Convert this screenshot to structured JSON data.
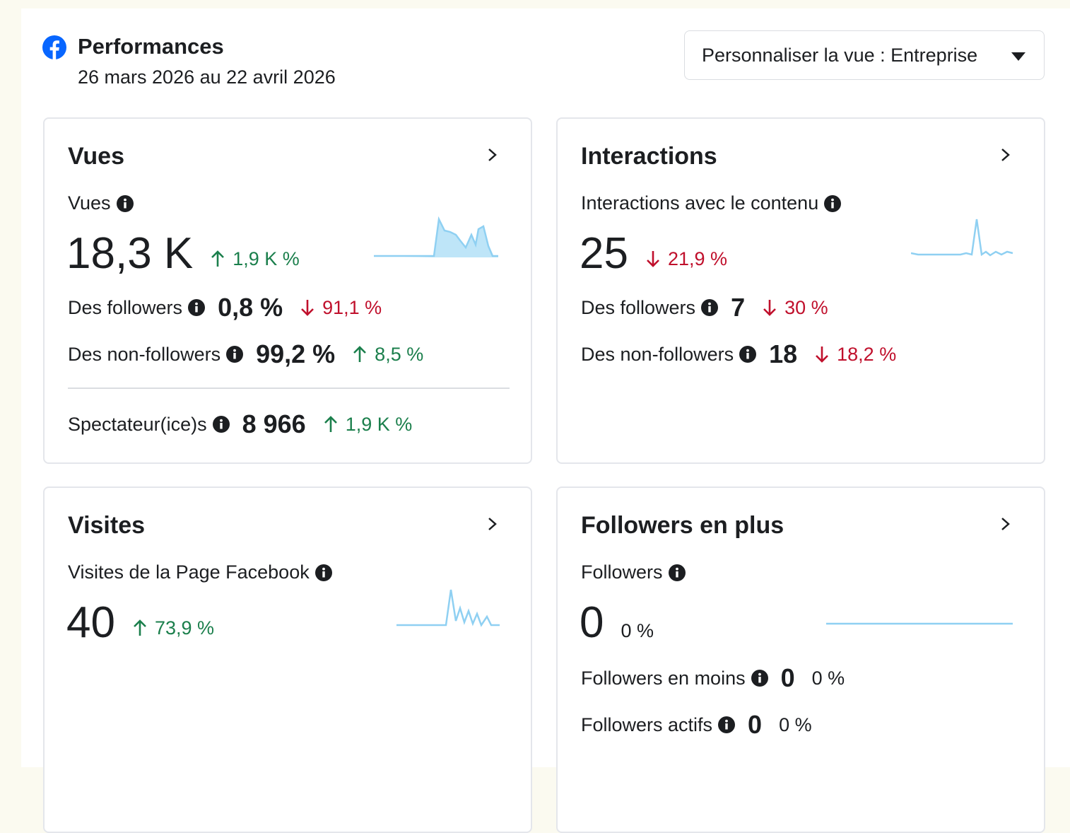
{
  "header": {
    "title": "Performances",
    "date_range": "26 mars 2026 au 22 avril 2026",
    "view_selector": "Personnaliser la vue : Entreprise"
  },
  "colors": {
    "up": "#1b7f4c",
    "down": "#c0102c",
    "facebook_blue": "#0866ff",
    "sparkline": "#8fd0f2"
  },
  "cards": {
    "vues": {
      "title": "Vues",
      "metric_label": "Vues",
      "value": "18,3 K",
      "delta": "1,9 K %",
      "delta_direction": "up",
      "rows": [
        {
          "label": "Des followers",
          "value": "0,8 %",
          "delta": "91,1 %",
          "direction": "down"
        },
        {
          "label": "Des non-followers",
          "value": "99,2 %",
          "delta": "8,5 %",
          "direction": "up"
        },
        {
          "label": "Spectateur(ice)s",
          "value": "8 966",
          "delta": "1,9 K %",
          "direction": "up"
        }
      ]
    },
    "interactions": {
      "title": "Interactions",
      "metric_label": "Interactions avec le contenu",
      "value": "25",
      "delta": "21,9 %",
      "delta_direction": "down",
      "rows": [
        {
          "label": "Des followers",
          "value": "7",
          "delta": "30 %",
          "direction": "down"
        },
        {
          "label": "Des non-followers",
          "value": "18",
          "delta": "18,2 %",
          "direction": "down"
        }
      ]
    },
    "visites": {
      "title": "Visites",
      "metric_label": "Visites de la Page Facebook",
      "value": "40",
      "delta": "73,9 %",
      "delta_direction": "up"
    },
    "followers": {
      "title": "Followers en plus",
      "metric_label": "Followers",
      "value": "0",
      "delta": "0 %",
      "delta_direction": "neutral",
      "rows": [
        {
          "label": "Followers en moins",
          "value": "0",
          "delta": "0 %",
          "direction": "neutral"
        },
        {
          "label": "Followers actifs",
          "value": "0",
          "delta": "0 %",
          "direction": "neutral"
        }
      ]
    }
  }
}
